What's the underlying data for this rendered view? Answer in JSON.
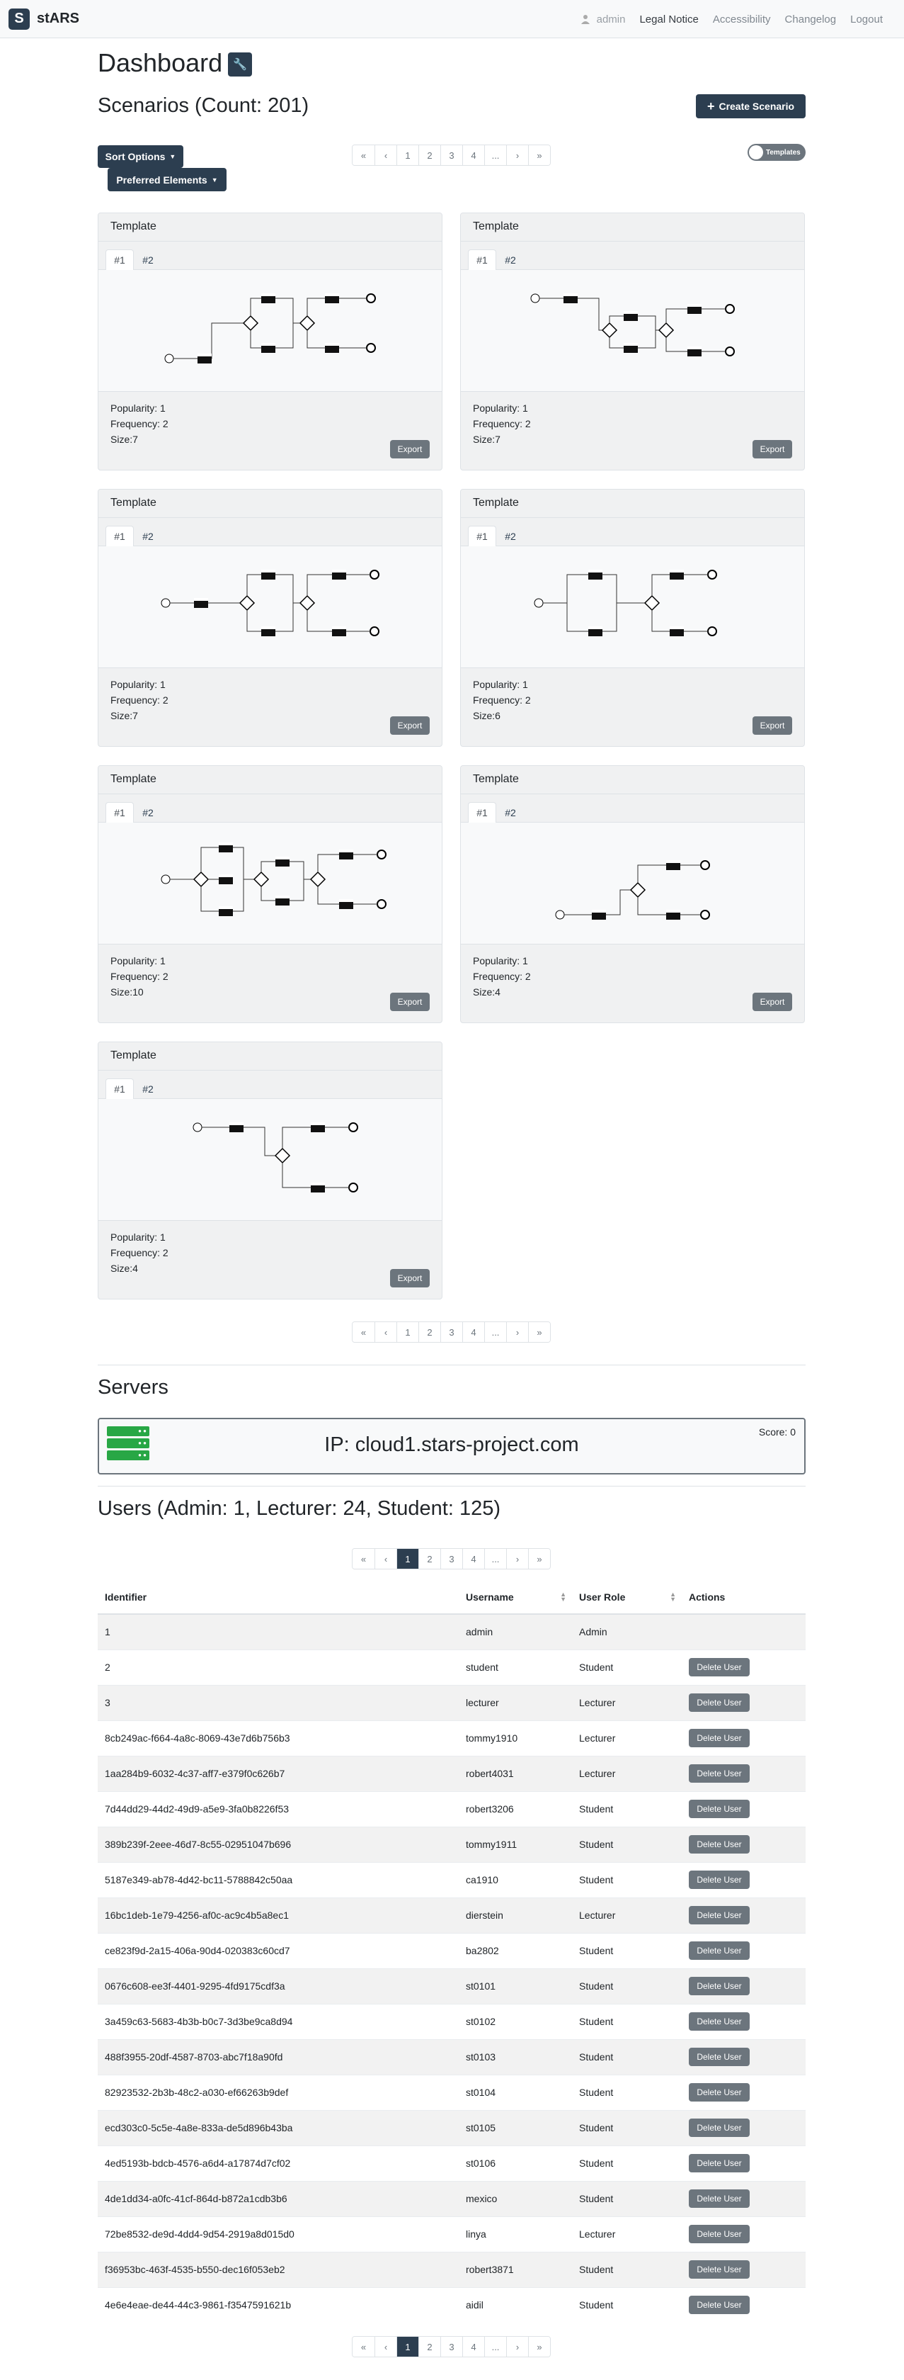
{
  "nav": {
    "brand": "stARS",
    "logo": "S",
    "user": "admin",
    "links": [
      "Legal Notice",
      "Accessibility",
      "Changelog",
      "Logout"
    ]
  },
  "page_title": "Dashboard",
  "scenarios": {
    "heading": "Scenarios (Count: 201)",
    "create_label": "Create Scenario",
    "sort_label": "Sort Options",
    "preferred_label": "Preferred Elements",
    "toggle_label": "Templates"
  },
  "pagination": [
    "«",
    "‹",
    "1",
    "2",
    "3",
    "4",
    "...",
    "›",
    "»"
  ],
  "cards": [
    {
      "title": "Template",
      "tabs": [
        "#1",
        "#2"
      ],
      "popularity": "Popularity: 1",
      "frequency": "Frequency: 2",
      "size": "Size:7",
      "export": "Export"
    },
    {
      "title": "Template",
      "tabs": [
        "#1",
        "#2"
      ],
      "popularity": "Popularity: 1",
      "frequency": "Frequency: 2",
      "size": "Size:7",
      "export": "Export"
    },
    {
      "title": "Template",
      "tabs": [
        "#1",
        "#2"
      ],
      "popularity": "Popularity: 1",
      "frequency": "Frequency: 2",
      "size": "Size:7",
      "export": "Export"
    },
    {
      "title": "Template",
      "tabs": [
        "#1",
        "#2"
      ],
      "popularity": "Popularity: 1",
      "frequency": "Frequency: 2",
      "size": "Size:6",
      "export": "Export"
    },
    {
      "title": "Template",
      "tabs": [
        "#1",
        "#2"
      ],
      "popularity": "Popularity: 1",
      "frequency": "Frequency: 2",
      "size": "Size:10",
      "export": "Export"
    },
    {
      "title": "Template",
      "tabs": [
        "#1",
        "#2"
      ],
      "popularity": "Popularity: 1",
      "frequency": "Frequency: 2",
      "size": "Size:4",
      "export": "Export"
    },
    {
      "title": "Template",
      "tabs": [
        "#1",
        "#2"
      ],
      "popularity": "Popularity: 1",
      "frequency": "Frequency: 2",
      "size": "Size:4",
      "export": "Export"
    }
  ],
  "servers": {
    "heading": "Servers",
    "ip": "IP: cloud1.stars-project.com",
    "score": "Score: 0"
  },
  "users": {
    "heading": "Users (Admin: 1, Lecturer: 24, Student: 125)",
    "columns": [
      "Identifier",
      "Username",
      "User Role",
      "Actions"
    ],
    "delete_label": "Delete User",
    "rows": [
      [
        "1",
        "admin",
        "Admin"
      ],
      [
        "2",
        "student",
        "Student"
      ],
      [
        "3",
        "lecturer",
        "Lecturer"
      ],
      [
        "8cb249ac-f664-4a8c-8069-43e7d6b756b3",
        "tommy1910",
        "Lecturer"
      ],
      [
        "1aa284b9-6032-4c37-aff7-e379f0c626b7",
        "robert4031",
        "Lecturer"
      ],
      [
        "7d44dd29-44d2-49d9-a5e9-3fa0b8226f53",
        "robert3206",
        "Student"
      ],
      [
        "389b239f-2eee-46d7-8c55-02951047b696",
        "tommy1911",
        "Student"
      ],
      [
        "5187e349-ab78-4d42-bc11-5788842c50aa",
        "ca1910",
        "Student"
      ],
      [
        "16bc1deb-1e79-4256-af0c-ac9c4b5a8ec1",
        "dierstein",
        "Lecturer"
      ],
      [
        "ce823f9d-2a15-406a-90d4-020383c60cd7",
        "ba2802",
        "Student"
      ],
      [
        "0676c608-ee3f-4401-9295-4fd9175cdf3a",
        "st0101",
        "Student"
      ],
      [
        "3a459c63-5683-4b3b-b0c7-3d3be9ca8d94",
        "st0102",
        "Student"
      ],
      [
        "488f3955-20df-4587-8703-abc7f18a90fd",
        "st0103",
        "Student"
      ],
      [
        "82923532-2b3b-48c2-a030-ef66263b9def",
        "st0104",
        "Student"
      ],
      [
        "ecd303c0-5c5e-4a8e-833a-de5d896b43ba",
        "st0105",
        "Student"
      ],
      [
        "4ed5193b-bdcb-4576-a6d4-a17874d7cf02",
        "st0106",
        "Student"
      ],
      [
        "4de1dd34-a0fc-41cf-864d-b872a1cdb3b6",
        "mexico",
        "Student"
      ],
      [
        "72be8532-de9d-4dd4-9d54-2919a8d015d0",
        "linya",
        "Lecturer"
      ],
      [
        "f36953bc-463f-4535-b550-dec16f053eb2",
        "robert3871",
        "Student"
      ],
      [
        "4e6e4eae-de44-44c3-9861-f3547591621b",
        "aidil",
        "Student"
      ]
    ]
  }
}
